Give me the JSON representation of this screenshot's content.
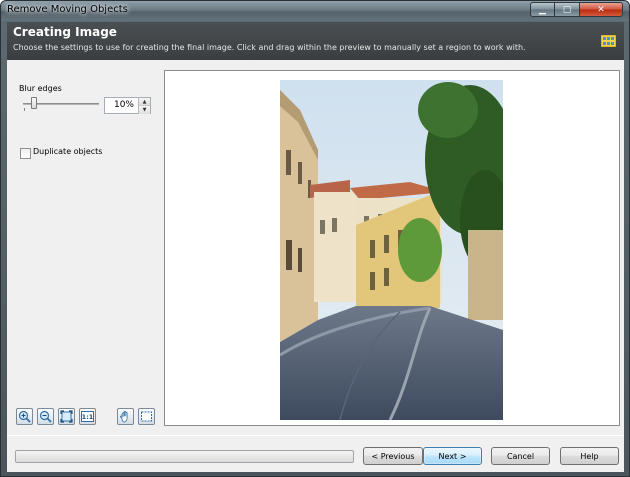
{
  "window": {
    "title": "Remove Moving Objects"
  },
  "header": {
    "title": "Creating Image",
    "description": "Choose the settings to use for creating the final image. Click and drag within the preview to manually set a region to work with."
  },
  "settings": {
    "blur_label": "Blur edges",
    "blur_value": "10%",
    "blur_level_fraction": 0.1,
    "duplicate_label": "Duplicate objects",
    "duplicate_checked": false
  },
  "tools": [
    "zoom-in-icon",
    "zoom-out-icon",
    "fit-to-window-icon",
    "actual-size-icon",
    "hand-pan-icon",
    "select-region-icon"
  ],
  "tool_labels": {
    "actual_size": "1:1"
  },
  "footer": {
    "previous_label": "< Previous",
    "next_label": "Next >",
    "cancel_label": "Cancel",
    "help_label": "Help"
  },
  "colors": {
    "header_bg": "#3f4346",
    "accent": "#3c7fb1"
  }
}
